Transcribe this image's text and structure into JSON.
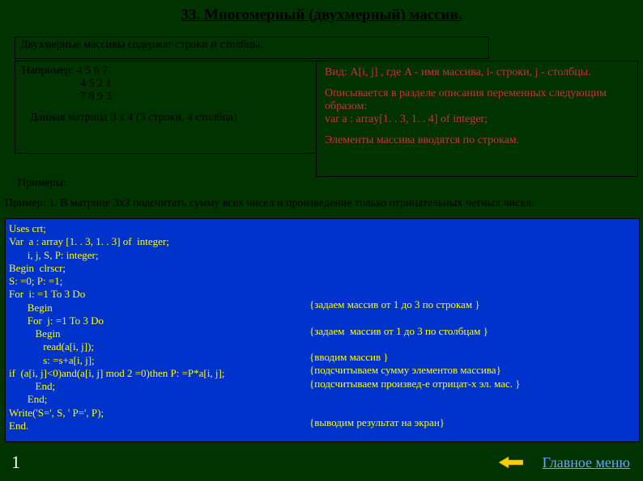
{
  "title": "33. Многомерный (двухмерный) массив.",
  "intro": "Двухмерные массивы содержат строки и столбцы.",
  "example": {
    "label": "Например:",
    "row1": "4  5  6  7",
    "row2": "4  5  2  1",
    "row3": "7  8  9  3",
    "caption": "Данная матрица 3 x 4 (3 строки, 4 столбца)"
  },
  "info": {
    "vid": "Вид:  A[i, j]  , где  A - имя массива, i- строки, j - столбцы.",
    "desc1": "Описывается в разделе описания переменных следующим образом:",
    "desc2": "  var a : array[1. . 3, 1. . 4] of  integer;",
    "elem": "Элементы массива вводятся по строкам."
  },
  "primery": "Примеры:",
  "ex1": "Пример: 1.  В матрице 3x3  подсчитать сумму всех чисел и произведение только отрицательных четных чисел.",
  "code": {
    "l1": "Uses crt;",
    "l2": "Var  a : array [1. . 3, 1. . 3] of  integer;",
    "l3": "       i, j, S, P: integer;",
    "l4": "Begin  clrscr;",
    "l5": "S: =0; P: =1;",
    "l6": "For  i: =1 To 3 Do",
    "l7": "       Begin",
    "l8": "       For  j: =1 To 3 Do",
    "l9": "          Begin",
    "l10": "             read(a[i, j]);",
    "l11": "             s: =s+a[i, j];",
    "l12": "if  (a[i, j]<0)and(a[i, j] mod 2 =0)then P: =P*a[i, j];",
    "l13": "          End;",
    "l14": "       End;",
    "l15": "Write('S=', S, ' P=', P);",
    "l16": "End.",
    "c1": "{задаем массив от 1 до 3 по строкам }",
    "c2": "{задаем  массив от 1 до 3 по столбцам }",
    "c3": "{вводим массив }",
    "c4": "{подсчитываем сумму элементов массива}",
    "c5": "{подсчитываем произвед-е отрицат-х эл. мас. }",
    "c6": "{выводим результат на экран}"
  },
  "page": "1",
  "home": "Главное меню"
}
